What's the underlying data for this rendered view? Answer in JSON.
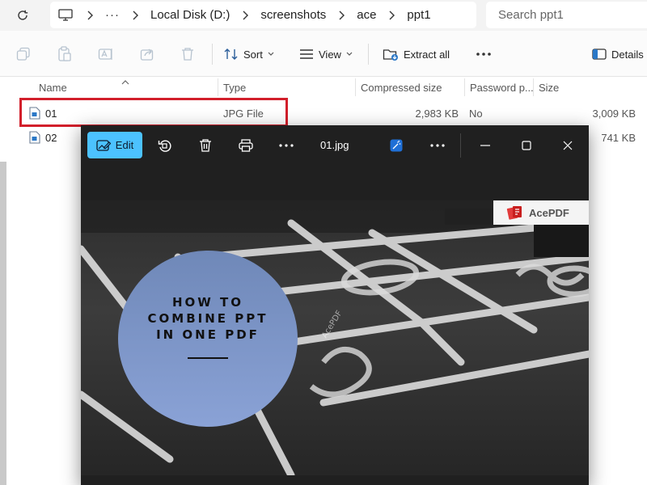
{
  "address_bar": {
    "breadcrumbs": [
      "Local Disk (D:)",
      "screenshots",
      "ace",
      "ppt1"
    ],
    "search_placeholder": "Search ppt1"
  },
  "toolbar": {
    "sort_label": "Sort",
    "view_label": "View",
    "extract_label": "Extract all",
    "details_label": "Details"
  },
  "columns": {
    "name": "Name",
    "type": "Type",
    "compressed_size": "Compressed size",
    "password": "Password p...",
    "size": "Size"
  },
  "files": [
    {
      "name": "01",
      "type": "JPG File",
      "compressed": "2,983 KB",
      "password": "No",
      "size": "3,009 KB"
    },
    {
      "name": "02",
      "size": "741 KB"
    }
  ],
  "viewer": {
    "edit_label": "Edit",
    "filename": "01.jpg",
    "image": {
      "title_lines": [
        "HOW TO",
        "COMBINE PPT",
        "IN ONE PDF"
      ],
      "brand": "AcePDF",
      "watermark": "AcePDF"
    }
  },
  "colors": {
    "highlight": "#d21f2b",
    "edit_accent": "#4cc2ff",
    "viewer_bg": "#202020"
  }
}
